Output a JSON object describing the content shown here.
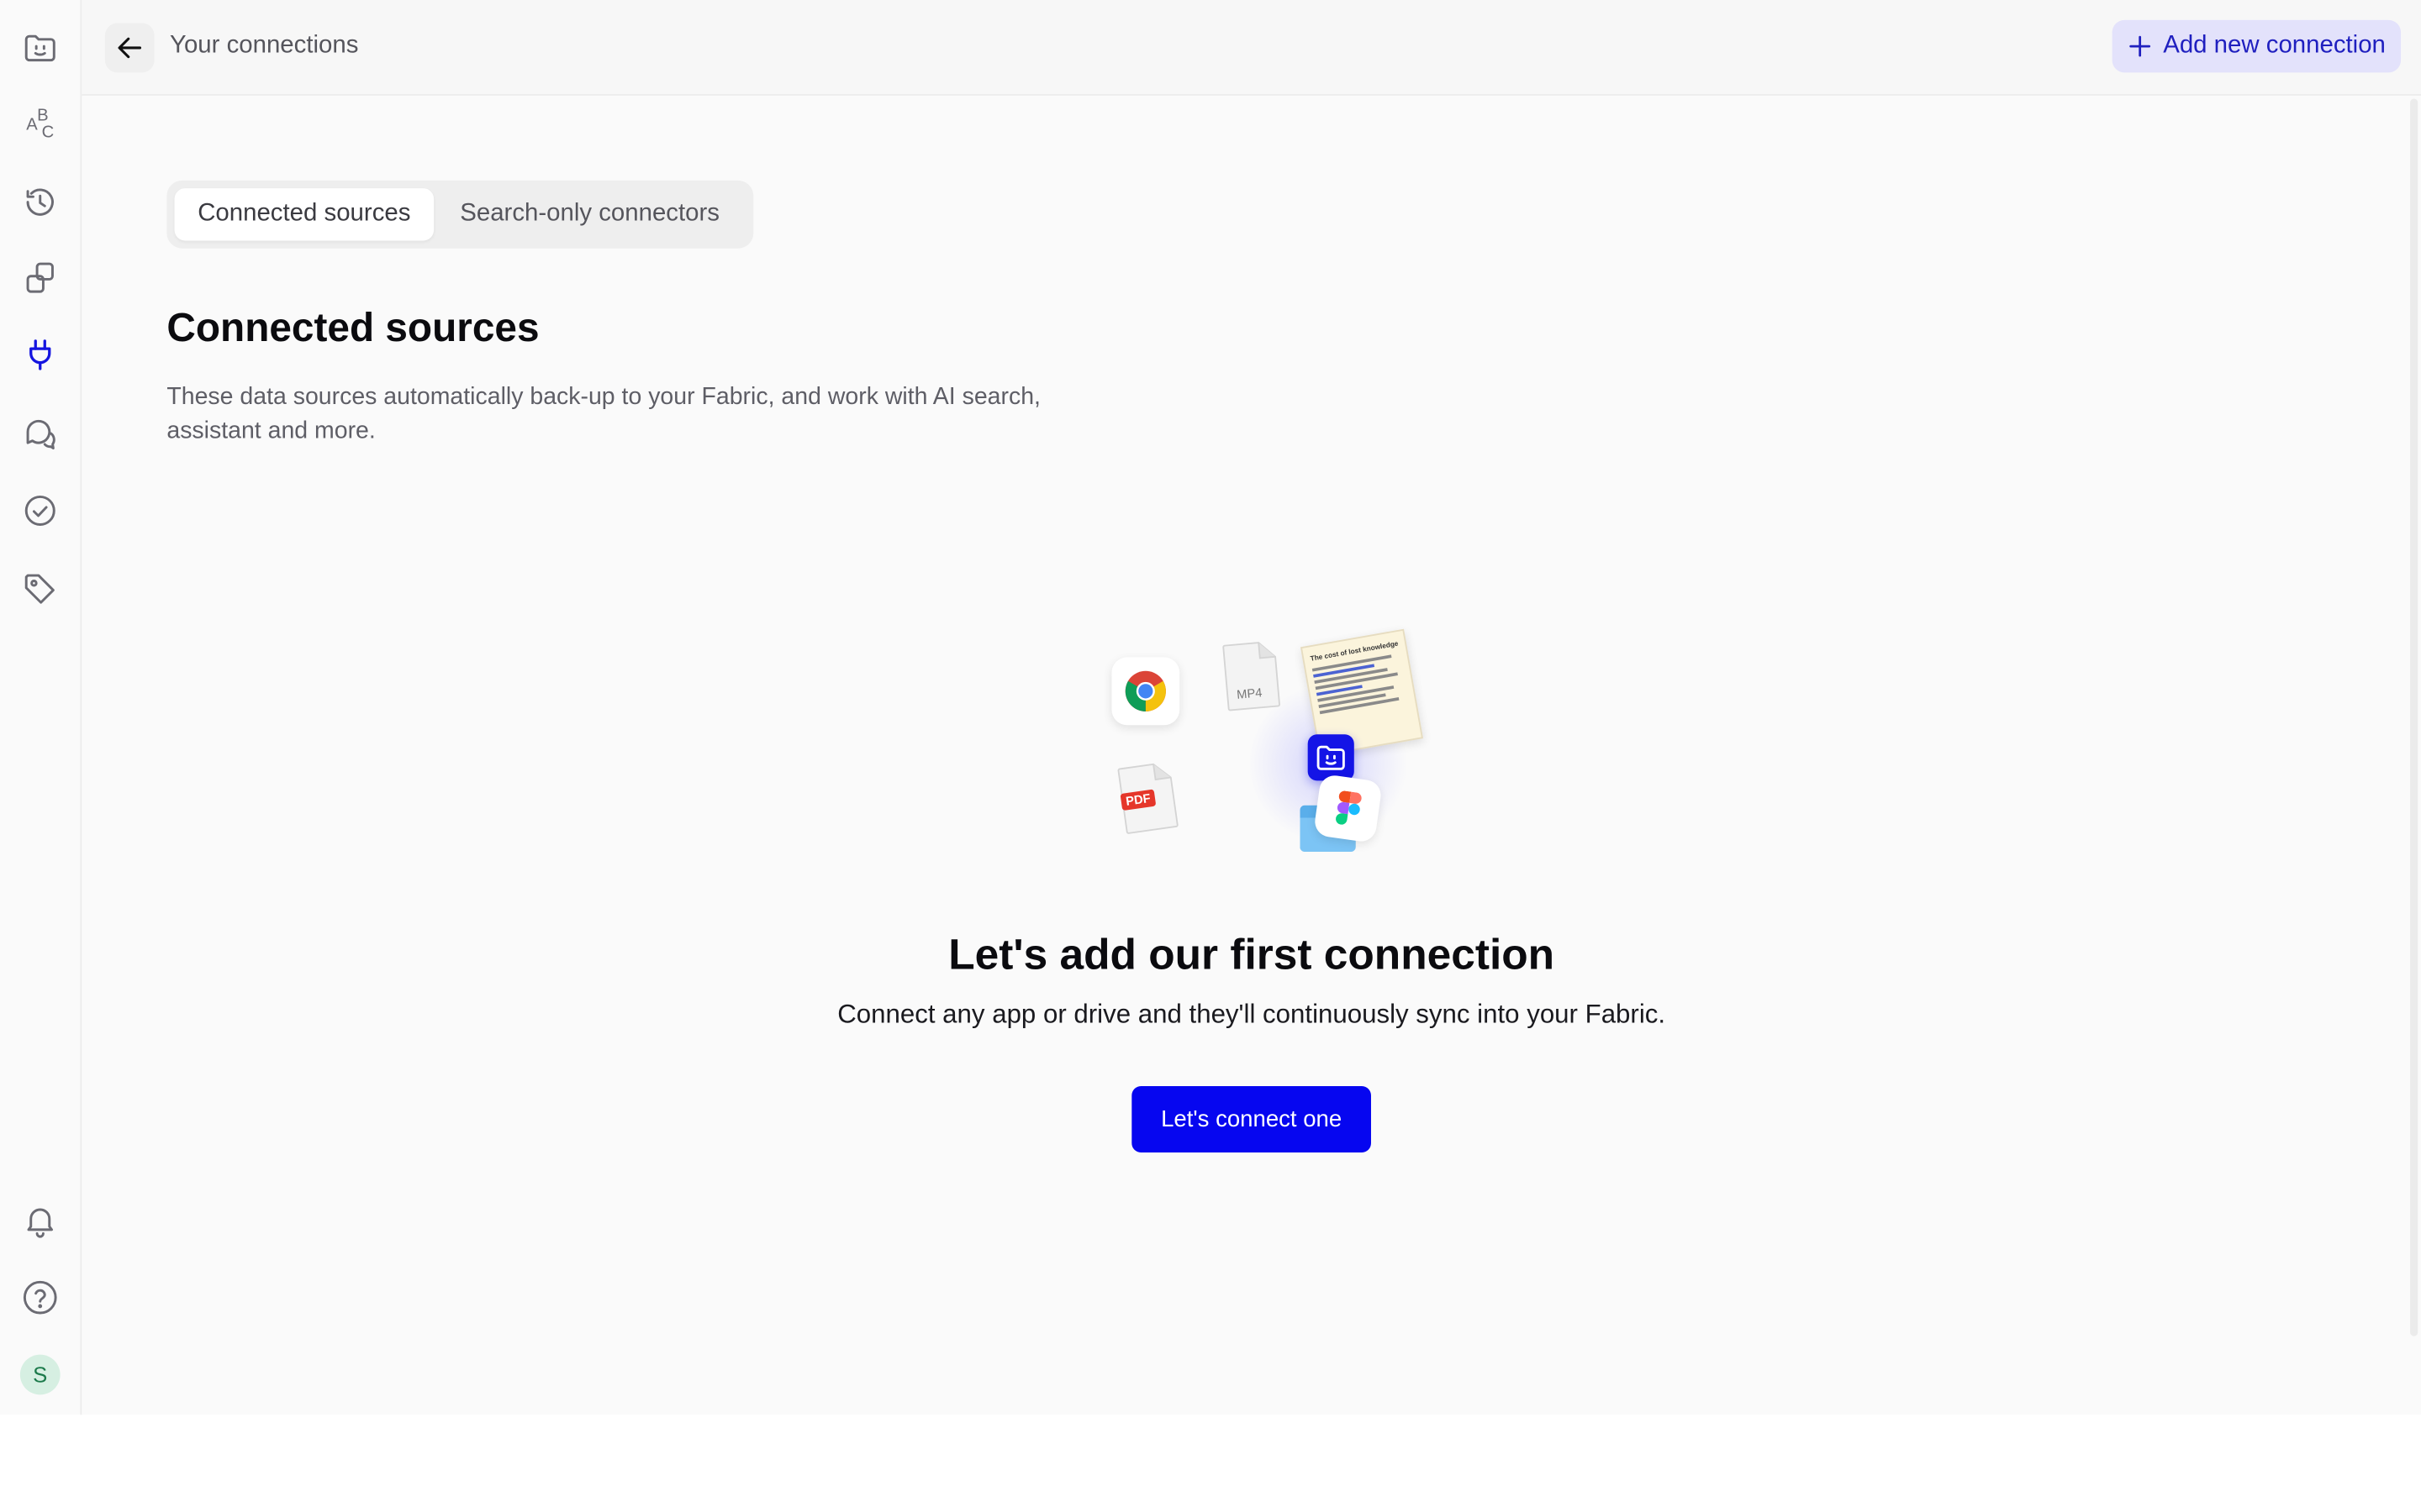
{
  "topbar": {
    "title": "Your connections",
    "add_button_label": "Add new connection"
  },
  "tabs": [
    {
      "label": "Connected sources",
      "active": true
    },
    {
      "label": "Search-only connectors",
      "active": false
    }
  ],
  "section": {
    "title": "Connected sources",
    "description": "These data sources automatically back-up to your Fabric, and work with AI search, assistant and more."
  },
  "empty_state": {
    "title": "Let's add our first connection",
    "subtitle": "Connect any app or drive and they'll continuously sync into your Fabric.",
    "cta_label": "Let's connect one"
  },
  "illustration": {
    "mp4_label": "MP4",
    "pdf_label": "PDF",
    "note_heading": "The cost of lost knowledge"
  },
  "sidebar": {
    "abc_letters": [
      "A",
      "B",
      "C"
    ],
    "avatar_initial": "S",
    "active_item": "connections-icon"
  },
  "colors": {
    "accent": "#0606f0",
    "accent_soft": "#e3e2fb",
    "active_icon": "#1515e0",
    "background": "#fafafa"
  }
}
